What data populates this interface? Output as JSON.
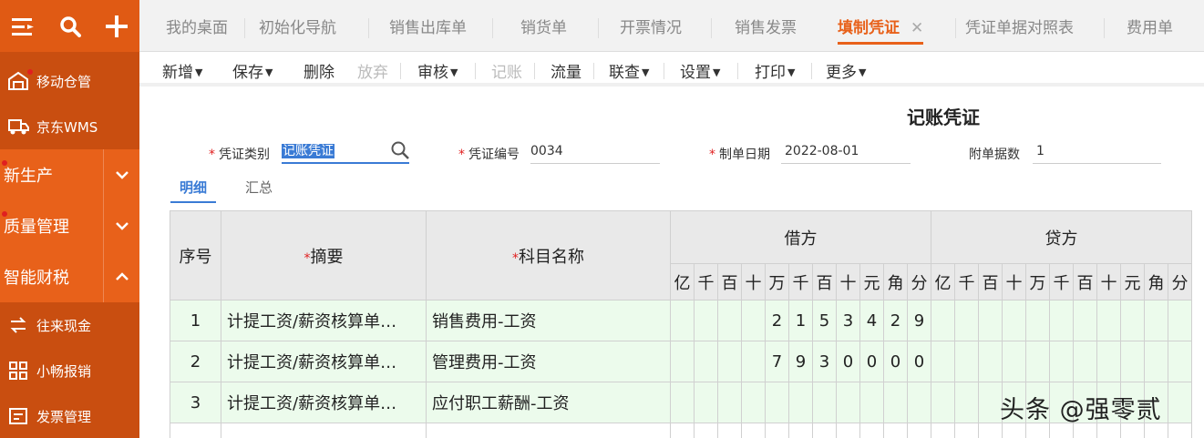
{
  "sidebar": {
    "items": [
      {
        "label": "移动仓管",
        "icon": "warehouse-icon"
      },
      {
        "label": "京东WMS",
        "icon": "truck-icon"
      }
    ],
    "groups": [
      {
        "label": "新生产",
        "expanded": false
      },
      {
        "label": "质量管理",
        "expanded": false
      },
      {
        "label": "智能财税",
        "expanded": true
      }
    ],
    "sub_items": [
      {
        "label": "往来现金",
        "icon": "exchange-icon"
      },
      {
        "label": "小畅报销",
        "icon": "grid-icon"
      },
      {
        "label": "发票管理",
        "icon": "invoice-icon"
      }
    ]
  },
  "tabs": [
    {
      "label": "我的桌面"
    },
    {
      "label": "初始化导航"
    },
    {
      "label": "销售出库单"
    },
    {
      "label": "销货单"
    },
    {
      "label": "开票情况"
    },
    {
      "label": "销售发票"
    },
    {
      "label": "填制凭证",
      "active": true
    },
    {
      "label": "凭证单据对照表"
    },
    {
      "label": "费用单"
    }
  ],
  "toolbar": {
    "add": "新增",
    "save": "保存",
    "delete": "删除",
    "discard": "放弃",
    "audit": "审核",
    "post": "记账",
    "flow": "流量",
    "query": "联查",
    "settings": "设置",
    "print": "打印",
    "more": "更多"
  },
  "voucher": {
    "title": "记账凭证",
    "type_label": "凭证类别",
    "type_value": "记账凭证",
    "number_label": "凭证编号",
    "number_value": "0034",
    "date_label": "制单日期",
    "date_value": "2022-08-01",
    "attach_label": "附单据数",
    "attach_value": "1"
  },
  "subtabs": {
    "detail": "明细",
    "summary": "汇总"
  },
  "table": {
    "headers": {
      "seq": "序号",
      "summary": "摘要",
      "account": "科目名称",
      "debit": "借方",
      "credit": "贷方"
    },
    "digit_units": [
      "亿",
      "千",
      "百",
      "十",
      "万",
      "千",
      "百",
      "十",
      "元",
      "角",
      "分"
    ],
    "rows": [
      {
        "seq": "1",
        "summary": "计提工资/薪资核算单…",
        "account": "销售费用-工资",
        "debit": [
          "",
          "",
          "",
          "",
          "2",
          "1",
          "5",
          "3",
          "4",
          "2",
          "9"
        ],
        "credit": [
          "",
          "",
          "",
          "",
          "",
          "",
          "",
          "",
          "",
          "",
          ""
        ]
      },
      {
        "seq": "2",
        "summary": "计提工资/薪资核算单…",
        "account": "管理费用-工资",
        "debit": [
          "",
          "",
          "",
          "",
          "7",
          "9",
          "3",
          "0",
          "0",
          "0",
          "0"
        ],
        "credit": [
          "",
          "",
          "",
          "",
          "",
          "",
          "",
          "",
          "",
          "",
          ""
        ]
      },
      {
        "seq": "3",
        "summary": "计提工资/薪资核算单…",
        "account": "应付职工薪酬-工资",
        "debit": [
          "",
          "",
          "",
          "",
          "",
          "",
          "",
          "",
          "",
          "",
          ""
        ],
        "credit": [
          "",
          "",
          "",
          "",
          "",
          "",
          "",
          "",
          "",
          "",
          ""
        ]
      }
    ]
  },
  "watermark": "头条 @强零贰",
  "colors": {
    "accent": "#e8611a",
    "selection": "#3a7bd5",
    "row_bg": "#ecfbec"
  }
}
